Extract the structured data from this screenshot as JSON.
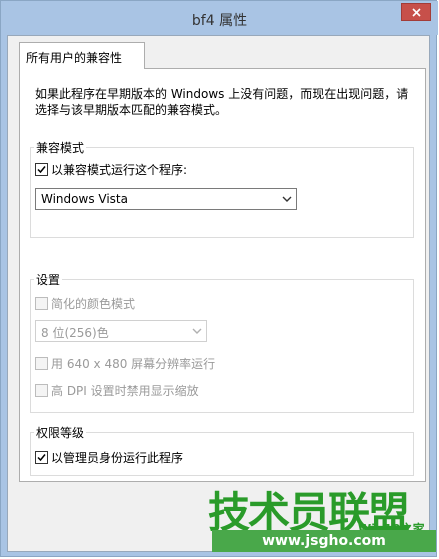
{
  "window": {
    "title": "bf4 属性"
  },
  "tab": {
    "label": "所有用户的兼容性"
  },
  "intro": {
    "text": "如果此程序在早期版本的 Windows 上没有问题，而现在出现问题，请选择与该早期版本匹配的兼容模式。"
  },
  "compat": {
    "legend": "兼容模式",
    "checkbox_label": "以兼容模式运行这个程序:",
    "checked": true,
    "selected_os": "Windows Vista"
  },
  "settings": {
    "legend": "设置",
    "reduced_color_label": "简化的颜色模式",
    "color_mode_value": "8 位(256)色",
    "res_label": "用 640 x 480 屏幕分辨率运行",
    "dpi_label": "高 DPI 设置时禁用显示缩放"
  },
  "privilege": {
    "legend": "权限等级",
    "admin_label": "以管理员身份运行此程序",
    "checked": true
  },
  "watermark": {
    "main": "技术员联盟",
    "tag": "Win10之家",
    "url": "www.jsgho.com"
  },
  "colors": {
    "accent": "#a9c4e4",
    "close": "#c7504a",
    "watermark": "#2a9b2a"
  }
}
